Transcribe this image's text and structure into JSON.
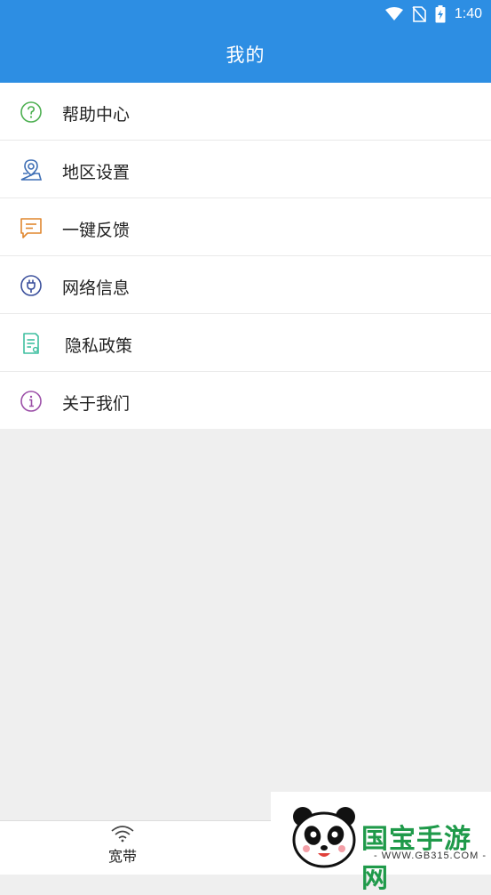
{
  "status_bar": {
    "time": "1:40"
  },
  "header": {
    "title": "我的"
  },
  "menu": {
    "items": [
      {
        "label": "帮助中心",
        "icon": "help-icon",
        "color": "#4caf50"
      },
      {
        "label": "地区设置",
        "icon": "location-pin-icon",
        "color": "#3f6fb5"
      },
      {
        "label": "一键反馈",
        "icon": "feedback-icon",
        "color": "#e0872f"
      },
      {
        "label": "网络信息",
        "icon": "plug-icon",
        "color": "#3a4f9c"
      },
      {
        "label": "隐私政策",
        "icon": "document-icon",
        "color": "#3fbfa0"
      },
      {
        "label": "关于我们",
        "icon": "info-icon",
        "color": "#9c4fa8"
      }
    ]
  },
  "tabbar": {
    "tabs": [
      {
        "label": "宽带",
        "icon": "wifi-icon"
      }
    ]
  },
  "watermark": {
    "text": "国宝手游网",
    "url": "- WWW.GB315.COM -"
  }
}
